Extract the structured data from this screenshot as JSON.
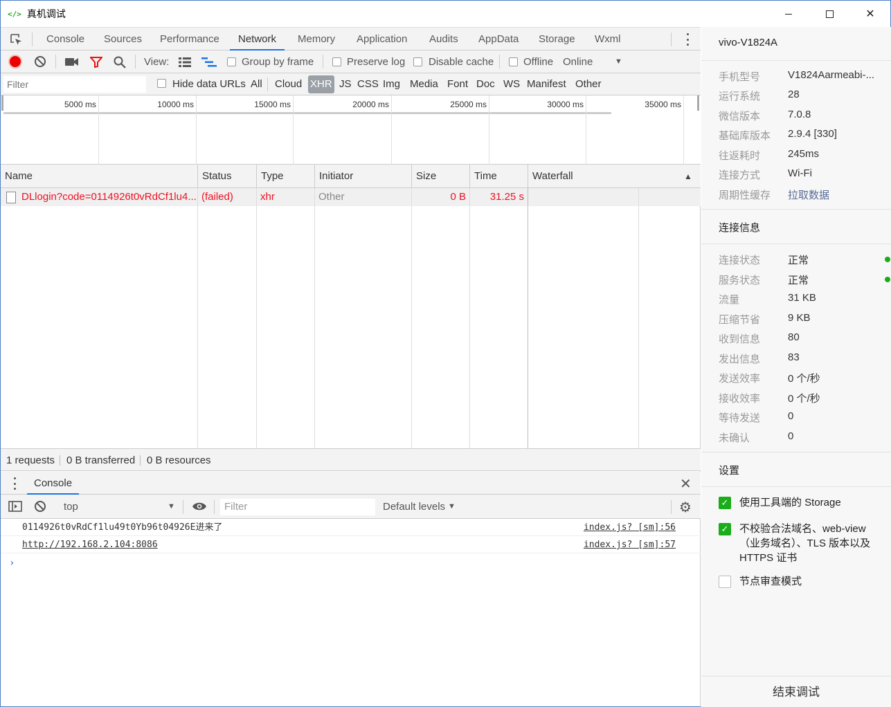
{
  "window": {
    "title": "真机调试",
    "icon": "code-brackets-icon"
  },
  "devtools": {
    "tabs": [
      "Console",
      "Sources",
      "Performance",
      "Network",
      "Memory",
      "Application",
      "Audits",
      "AppData",
      "Storage",
      "Wxml"
    ],
    "active_tab": "Network",
    "toolbar": {
      "view_label": "View:",
      "group_by_frame": "Group by frame",
      "preserve_log": "Preserve log",
      "disable_cache": "Disable cache",
      "offline": "Offline",
      "throttle": "Online"
    },
    "filter": {
      "placeholder": "Filter",
      "hide_data_urls": "Hide data URLs",
      "types": [
        "All",
        "Cloud",
        "XHR",
        "JS",
        "CSS",
        "Img",
        "Media",
        "Font",
        "Doc",
        "WS",
        "Manifest",
        "Other"
      ],
      "selected": "XHR"
    },
    "overview": {
      "ticks": [
        "5000 ms",
        "10000 ms",
        "15000 ms",
        "20000 ms",
        "25000 ms",
        "30000 ms",
        "35000 ms"
      ]
    },
    "table": {
      "columns": [
        "Name",
        "Status",
        "Type",
        "Initiator",
        "Size",
        "Time",
        "Waterfall"
      ],
      "rows": [
        {
          "name": "DLlogin?code=0114926t0vRdCf1lu4...",
          "status": "(failed)",
          "type": "xhr",
          "initiator": "Other",
          "size": "0 B",
          "time": "31.25 s"
        }
      ]
    },
    "summary": {
      "requests": "1 requests",
      "transferred": "0 B transferred",
      "resources": "0 B resources"
    },
    "console": {
      "tab": "Console",
      "context": "top",
      "filter_placeholder": "Filter",
      "levels": "Default levels",
      "lines": [
        {
          "message": "0114926t0vRdCf1lu49t0Yb96t04926E进来了",
          "source": "index.js? [sm]:56"
        },
        {
          "message": "http://192.168.2.104:8086",
          "source": "index.js? [sm]:57"
        }
      ],
      "prompt": "›"
    }
  },
  "side": {
    "device": "vivo-V1824A",
    "info": [
      {
        "k": "手机型号",
        "v": "V1824Aarmeabi-..."
      },
      {
        "k": "运行系统",
        "v": "28"
      },
      {
        "k": "微信版本",
        "v": "7.0.8"
      },
      {
        "k": "基础库版本",
        "v": "2.9.4 [330]"
      },
      {
        "k": "往返耗时",
        "v": "245ms"
      },
      {
        "k": "连接方式",
        "v": "Wi-Fi"
      },
      {
        "k": "周期性缓存",
        "v": "拉取数据"
      }
    ],
    "conn_title": "连接信息",
    "conn": [
      {
        "k": "连接状态",
        "v": "正常"
      },
      {
        "k": "服务状态",
        "v": "正常"
      },
      {
        "k": "流量",
        "v": "31 KB"
      },
      {
        "k": "压缩节省",
        "v": "9 KB"
      },
      {
        "k": "收到信息",
        "v": "80"
      },
      {
        "k": "发出信息",
        "v": "83"
      },
      {
        "k": "发送效率",
        "v": "0 个/秒"
      },
      {
        "k": "接收效率",
        "v": "0 个/秒"
      },
      {
        "k": "等待发送",
        "v": "0"
      },
      {
        "k": "未确认",
        "v": "0"
      }
    ],
    "settings_title": "设置",
    "settings": [
      {
        "label": "使用工具端的 Storage",
        "checked": true
      },
      {
        "label": "不校验合法域名、web-view（业务域名）、TLS 版本以及 HTTPS 证书",
        "checked": true
      },
      {
        "label": "节点审查模式",
        "checked": false
      }
    ],
    "end_button": "结束调试",
    "status_color": "#1aad19",
    "link_color": "#576b95"
  }
}
